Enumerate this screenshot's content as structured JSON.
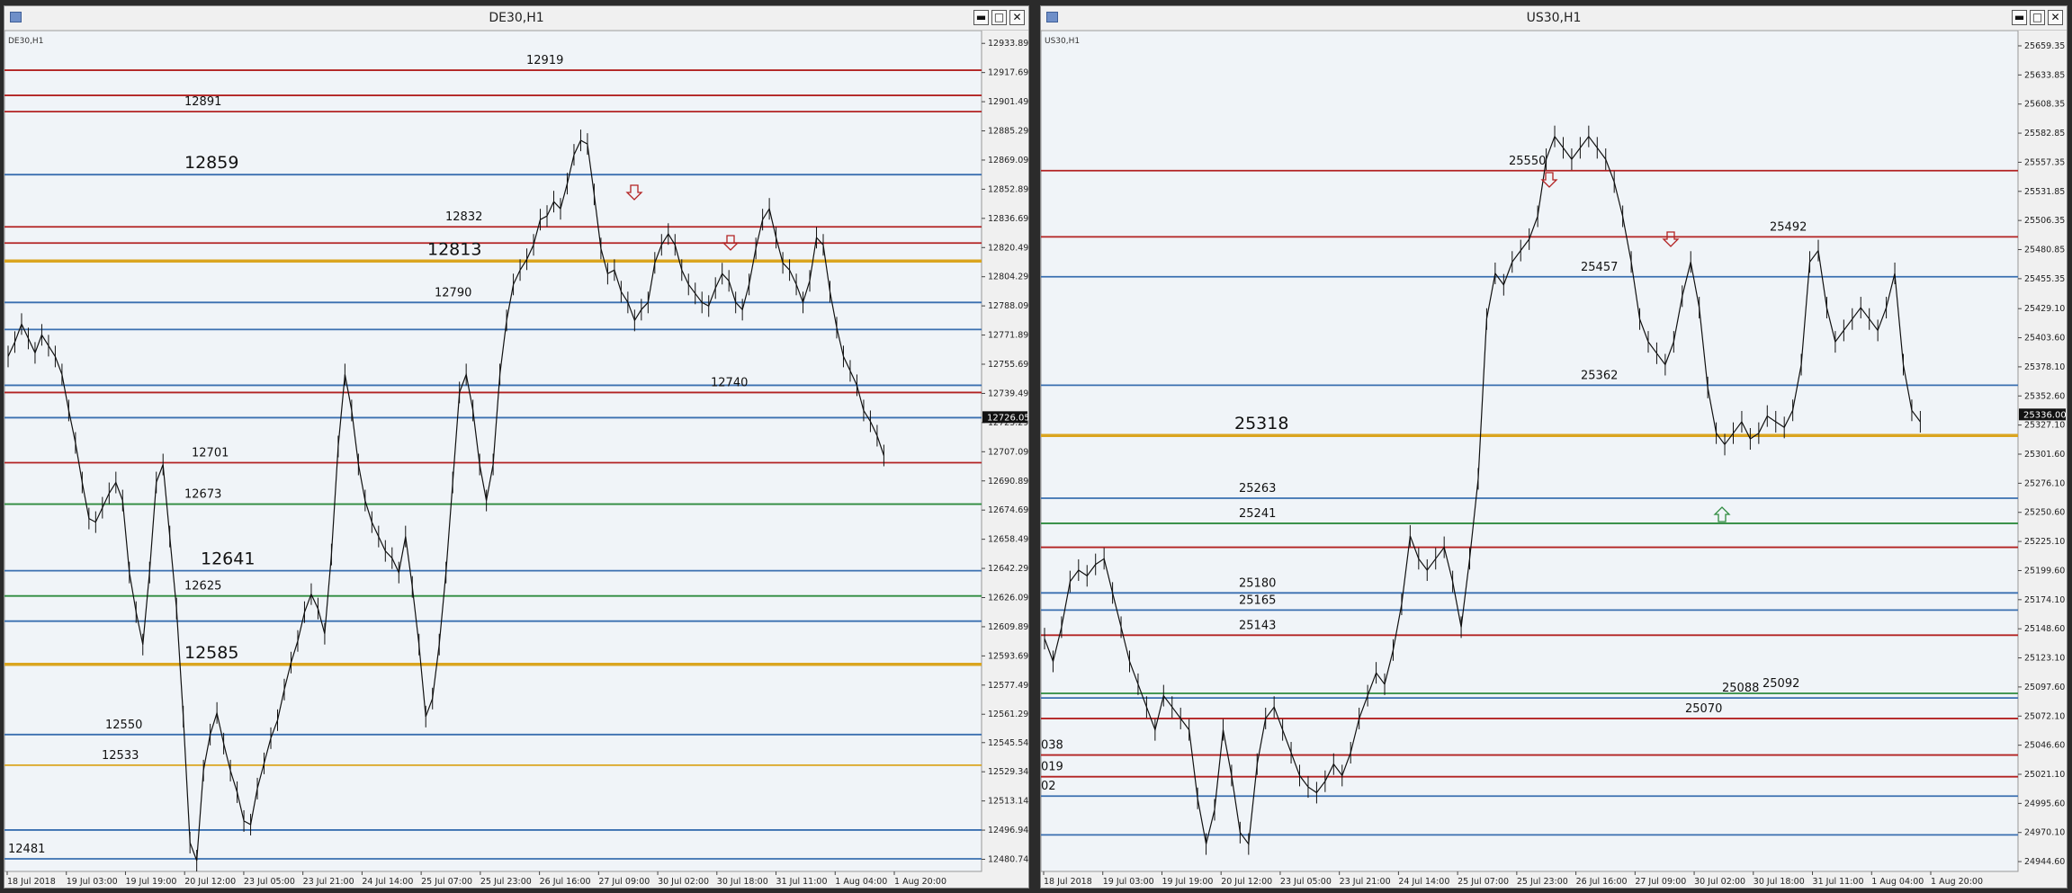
{
  "windows": [
    {
      "title": "DE30,H1",
      "symbol_label": "DE30,H1",
      "buttons": {
        "minimize": "▬",
        "maximize": "□",
        "close": "✕"
      },
      "chart_data": {
        "type": "line",
        "title": "DE30,H1",
        "ylim": [
          12474,
          12938
        ],
        "y_ticks": [
          "12933.89",
          "12917.69",
          "12901.49",
          "12885.29",
          "12869.09",
          "12852.89",
          "12836.69",
          "12820.49",
          "12804.29",
          "12788.09",
          "12771.89",
          "12755.69",
          "12739.49",
          "12723.29",
          "12707.09",
          "12690.89",
          "12674.69",
          "12658.49",
          "12642.29",
          "12626.09",
          "12609.89",
          "12593.69",
          "12577.49",
          "12561.29",
          "12545.54",
          "12529.34",
          "12513.14",
          "12496.94",
          "12480.74"
        ],
        "current_price": "12726.05",
        "x_ticks": [
          "18 Jul 2018",
          "19 Jul 03:00",
          "19 Jul 19:00",
          "20 Jul 12:00",
          "23 Jul 05:00",
          "23 Jul 21:00",
          "24 Jul 14:00",
          "25 Jul 07:00",
          "25 Jul 23:00",
          "26 Jul 16:00",
          "27 Jul 09:00",
          "30 Jul 02:00",
          "30 Jul 18:00",
          "31 Jul 11:00",
          "1 Aug 04:00",
          "1 Aug 20:00"
        ],
        "series": [
          {
            "values": [
              12760,
              12768,
              12778,
              12770,
              12762,
              12772,
              12766,
              12760,
              12750,
              12730,
              12712,
              12690,
              12670,
              12668,
              12676,
              12684,
              12690,
              12680,
              12640,
              12618,
              12600,
              12640,
              12690,
              12700,
              12660,
              12620,
              12560,
              12490,
              12480,
              12530,
              12550,
              12562,
              12545,
              12530,
              12518,
              12502,
              12500,
              12520,
              12534,
              12548,
              12558,
              12575,
              12590,
              12602,
              12618,
              12628,
              12620,
              12606,
              12650,
              12710,
              12750,
              12730,
              12700,
              12680,
              12668,
              12660,
              12652,
              12648,
              12640,
              12660,
              12632,
              12600,
              12560,
              12570,
              12600,
              12640,
              12690,
              12740,
              12750,
              12730,
              12700,
              12680,
              12700,
              12750,
              12780,
              12800,
              12808,
              12814,
              12822,
              12836,
              12838,
              12846,
              12842,
              12856,
              12872,
              12880,
              12878,
              12850,
              12820,
              12806,
              12808,
              12796,
              12790,
              12780,
              12786,
              12790,
              12812,
              12822,
              12828,
              12822,
              12808,
              12800,
              12795,
              12790,
              12788,
              12798,
              12806,
              12802,
              12790,
              12786,
              12800,
              12820,
              12836,
              12842,
              12826,
              12812,
              12808,
              12800,
              12790,
              12802,
              12826,
              12822,
              12796,
              12776,
              12760,
              12752,
              12744,
              12730,
              12724,
              12716,
              12705
            ]
          }
        ],
        "horizontal_levels": [
          {
            "value": 12919,
            "label": "12919",
            "color": "#b22222",
            "big": false
          },
          {
            "value": 12905,
            "label": "",
            "color": "#b22222",
            "big": false
          },
          {
            "value": 12896,
            "label": "12891",
            "color": "#b22222",
            "big": false
          },
          {
            "value": 12861,
            "label": "12859",
            "color": "#3a6fb0",
            "big": true
          },
          {
            "value": 12832,
            "label": "12832",
            "color": "#b22222",
            "big": false
          },
          {
            "value": 12823,
            "label": "",
            "color": "#b22222",
            "big": false
          },
          {
            "value": 12813,
            "label": "12813",
            "color": "#daa520",
            "big": true
          },
          {
            "value": 12790,
            "label": "12790",
            "color": "#3a6fb0",
            "big": false
          },
          {
            "value": 12775,
            "label": "",
            "color": "#3a6fb0",
            "big": false
          },
          {
            "value": 12744,
            "label": "",
            "color": "#3a6fb0",
            "big": false
          },
          {
            "value": 12740,
            "label": "12740",
            "color": "#b22222",
            "big": false
          },
          {
            "value": 12726,
            "label": "",
            "color": "#3a6fb0",
            "big": false
          },
          {
            "value": 12701,
            "label": "12701",
            "color": "#b22222",
            "big": false
          },
          {
            "value": 12678,
            "label": "12673",
            "color": "#2e8b3e",
            "big": false
          },
          {
            "value": 12641,
            "label": "12641",
            "color": "#3a6fb0",
            "big": true
          },
          {
            "value": 12627,
            "label": "12625",
            "color": "#2e8b3e",
            "big": false
          },
          {
            "value": 12613,
            "label": "",
            "color": "#3a6fb0",
            "big": false
          },
          {
            "value": 12589,
            "label": "12585",
            "color": "#daa520",
            "big": true
          },
          {
            "value": 12550,
            "label": "12550",
            "color": "#3a6fb0",
            "big": false
          },
          {
            "value": 12533,
            "label": "12533",
            "color": "#daa520",
            "big": false
          },
          {
            "value": 12497,
            "label": "",
            "color": "#3a6fb0",
            "big": false
          },
          {
            "value": 12481,
            "label": "12481",
            "color": "#3a6fb0",
            "big": false
          }
        ],
        "arrows": [
          {
            "direction": "down",
            "color": "#b22222"
          },
          {
            "direction": "down",
            "color": "#b22222"
          }
        ]
      }
    },
    {
      "title": "US30,H1",
      "symbol_label": "US30,H1",
      "buttons": {
        "minimize": "▬",
        "maximize": "□",
        "close": "✕"
      },
      "chart_data": {
        "type": "line",
        "title": "US30,H1",
        "ylim": [
          24936,
          25668
        ],
        "y_ticks": [
          "25659.35",
          "25633.85",
          "25608.35",
          "25582.85",
          "25557.35",
          "25531.85",
          "25506.35",
          "25480.85",
          "25455.35",
          "25429.10",
          "25403.60",
          "25378.10",
          "25352.60",
          "25327.10",
          "25301.60",
          "25276.10",
          "25250.60",
          "25225.10",
          "25199.60",
          "25174.10",
          "25148.60",
          "25123.10",
          "25097.60",
          "25072.10",
          "25046.60",
          "25021.10",
          "24995.60",
          "24970.10",
          "24944.60"
        ],
        "current_price": "25336.00",
        "x_ticks": [
          "18 Jul 2018",
          "19 Jul 03:00",
          "19 Jul 19:00",
          "20 Jul 12:00",
          "23 Jul 05:00",
          "23 Jul 21:00",
          "24 Jul 14:00",
          "25 Jul 07:00",
          "25 Jul 23:00",
          "26 Jul 16:00",
          "27 Jul 09:00",
          "30 Jul 02:00",
          "30 Jul 18:00",
          "31 Jul 11:00",
          "1 Aug 04:00",
          "1 Aug 20:00"
        ],
        "series": [
          {
            "values": [
              25140,
              25120,
              25150,
              25190,
              25200,
              25195,
              25205,
              25210,
              25180,
              25150,
              25120,
              25100,
              25080,
              25060,
              25090,
              25080,
              25070,
              25060,
              25000,
              24960,
              24990,
              25060,
              25020,
              24970,
              24960,
              25030,
              25070,
              25080,
              25060,
              25040,
              25020,
              25010,
              25005,
              25015,
              25030,
              25020,
              25040,
              25070,
              25090,
              25110,
              25100,
              25130,
              25170,
              25230,
              25210,
              25200,
              25210,
              25220,
              25190,
              25150,
              25210,
              25280,
              25420,
              25460,
              25450,
              25470,
              25480,
              25490,
              25510,
              25560,
              25580,
              25570,
              25560,
              25570,
              25580,
              25570,
              25560,
              25540,
              25510,
              25470,
              25420,
              25400,
              25390,
              25380,
              25400,
              25440,
              25470,
              25430,
              25360,
              25320,
              25310,
              25320,
              25330,
              25315,
              25320,
              25335,
              25330,
              25325,
              25340,
              25380,
              25470,
              25480,
              25430,
              25400,
              25410,
              25420,
              25430,
              25420,
              25410,
              25430,
              25460,
              25380,
              25340,
              25330
            ]
          }
        ],
        "horizontal_levels": [
          {
            "value": 25550,
            "label": "25550",
            "color": "#b22222",
            "big": false
          },
          {
            "value": 25492,
            "label": "25492",
            "color": "#b22222",
            "big": false
          },
          {
            "value": 25457,
            "label": "25457",
            "color": "#3a6fb0",
            "big": false
          },
          {
            "value": 25362,
            "label": "25362",
            "color": "#3a6fb0",
            "big": false
          },
          {
            "value": 25318,
            "label": "25318",
            "color": "#daa520",
            "big": true
          },
          {
            "value": 25263,
            "label": "25263",
            "color": "#3a6fb0",
            "big": false
          },
          {
            "value": 25241,
            "label": "25241",
            "color": "#2e8b3e",
            "big": false
          },
          {
            "value": 25220,
            "label": "",
            "color": "#b22222",
            "big": false
          },
          {
            "value": 25180,
            "label": "25180",
            "color": "#3a6fb0",
            "big": false
          },
          {
            "value": 25165,
            "label": "25165",
            "color": "#3a6fb0",
            "big": false
          },
          {
            "value": 25143,
            "label": "25143",
            "color": "#b22222",
            "big": false
          },
          {
            "value": 25092,
            "label": "25092",
            "color": "#2e8b3e",
            "big": false
          },
          {
            "value": 25088,
            "label": "25088",
            "color": "#3a6fb0",
            "big": false
          },
          {
            "value": 25070,
            "label": "25070",
            "color": "#b22222",
            "big": false
          },
          {
            "value": 25038,
            "label": "038",
            "color": "#b22222",
            "big": false
          },
          {
            "value": 25019,
            "label": "019",
            "color": "#b22222",
            "big": false
          },
          {
            "value": 25002,
            "label": "02",
            "color": "#3a6fb0",
            "big": false
          },
          {
            "value": 24968,
            "label": "",
            "color": "#3a6fb0",
            "big": false
          }
        ],
        "arrows": [
          {
            "direction": "down",
            "color": "#b22222"
          },
          {
            "direction": "down",
            "color": "#b22222"
          },
          {
            "direction": "up",
            "color": "#2e8b3e"
          }
        ]
      }
    }
  ]
}
